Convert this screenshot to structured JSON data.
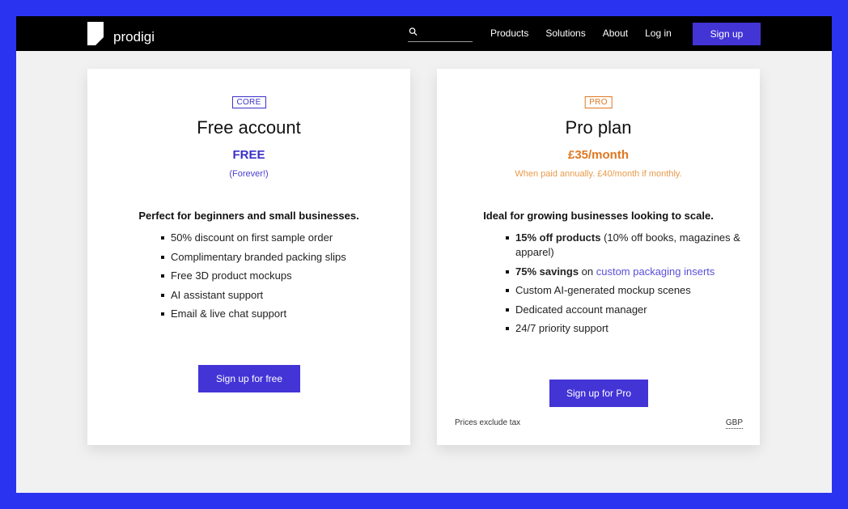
{
  "brand": {
    "name": "prodigi"
  },
  "search": {
    "placeholder": ""
  },
  "nav": {
    "items": [
      "Products",
      "Solutions",
      "About",
      "Log in"
    ],
    "signup_label": "Sign up"
  },
  "plans": {
    "core": {
      "badge": "CORE",
      "title": "Free account",
      "price": "FREE",
      "price_note": "(Forever!)",
      "headline": "Perfect for beginners and small businesses.",
      "features": [
        "50% discount on first sample order",
        "Complimentary branded packing slips",
        "Free 3D product mockups",
        "AI assistant support",
        "Email & live chat support"
      ],
      "cta": "Sign up for free"
    },
    "pro": {
      "badge": "PRO",
      "title": "Pro plan",
      "price": "£35/month",
      "price_note": "When paid annually. £40/month if monthly.",
      "headline": "Ideal for growing businesses looking to scale.",
      "features": [
        {
          "bold": "15% off products",
          "rest": " (10% off books, magazines & apparel)"
        },
        {
          "bold": "75% savings",
          "rest": " on ",
          "link": "custom packaging inserts"
        },
        {
          "rest": "Custom AI-generated mockup scenes"
        },
        {
          "rest": "Dedicated account manager"
        },
        {
          "rest": "24/7 priority support"
        }
      ],
      "cta": "Sign up for Pro",
      "footnote": "Prices exclude tax",
      "currency": "GBP"
    }
  },
  "colors": {
    "accent": "#4334d6",
    "pro_orange": "#e07720",
    "page_border": "#2a34f0"
  }
}
